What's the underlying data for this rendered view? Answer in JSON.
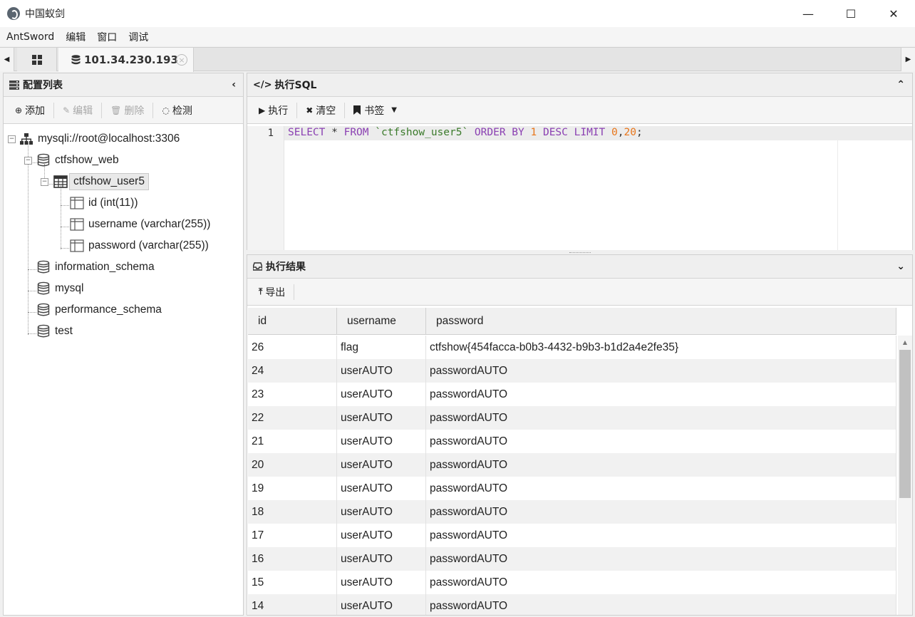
{
  "window": {
    "title": "中国蚁剑",
    "minimize_glyph": "—",
    "maximize_glyph": "☐",
    "close_glyph": "✕"
  },
  "menu": [
    "AntSword",
    "编辑",
    "窗口",
    "调试"
  ],
  "tabs": {
    "active_label": "101.34.230.193",
    "close_glyph": "×",
    "left_arrow": "◀",
    "right_arrow": "▶"
  },
  "config_panel": {
    "title": "配置列表",
    "collapse_glyph": "‹",
    "toolbar": {
      "add": "添加",
      "edit": "编辑",
      "delete": "删除",
      "check": "检测"
    },
    "tree": {
      "connection": "mysqli://root@localhost:3306",
      "db_ctfshow_web": "ctfshow_web",
      "table_user5": "ctfshow_user5",
      "col_id": "id (int(11))",
      "col_username": "username (varchar(255))",
      "col_password": "password (varchar(255))",
      "db_information_schema": "information_schema",
      "db_mysql": "mysql",
      "db_performance_schema": "performance_schema",
      "db_test": "test"
    }
  },
  "sql_panel": {
    "title": "执行SQL",
    "collapse_glyph": "⌃",
    "toolbar": {
      "execute": "执行",
      "clear": "清空",
      "bookmark": "书签"
    },
    "line_number": "1",
    "tokens": {
      "select": "SELECT",
      "star": " * ",
      "from": "FROM",
      "table": " `ctfshow_user5` ",
      "order_by": "ORDER BY",
      "one": " 1 ",
      "desc": "DESC",
      "limit": " LIMIT ",
      "zero": "0",
      "comma": ",",
      "twenty": "20",
      "semicolon": ";"
    }
  },
  "result_panel": {
    "title": "执行结果",
    "expand_glyph": "⌄",
    "export": "导出",
    "columns": [
      "id",
      "username",
      "password"
    ],
    "rows": [
      [
        "26",
        "flag",
        "ctfshow{454facca-b0b3-4432-b9b3-b1d2a4e2fe35}"
      ],
      [
        "24",
        "userAUTO",
        "passwordAUTO"
      ],
      [
        "23",
        "userAUTO",
        "passwordAUTO"
      ],
      [
        "22",
        "userAUTO",
        "passwordAUTO"
      ],
      [
        "21",
        "userAUTO",
        "passwordAUTO"
      ],
      [
        "20",
        "userAUTO",
        "passwordAUTO"
      ],
      [
        "19",
        "userAUTO",
        "passwordAUTO"
      ],
      [
        "18",
        "userAUTO",
        "passwordAUTO"
      ],
      [
        "17",
        "userAUTO",
        "passwordAUTO"
      ],
      [
        "16",
        "userAUTO",
        "passwordAUTO"
      ],
      [
        "15",
        "userAUTO",
        "passwordAUTO"
      ],
      [
        "14",
        "userAUTO",
        "passwordAUTO"
      ]
    ]
  }
}
